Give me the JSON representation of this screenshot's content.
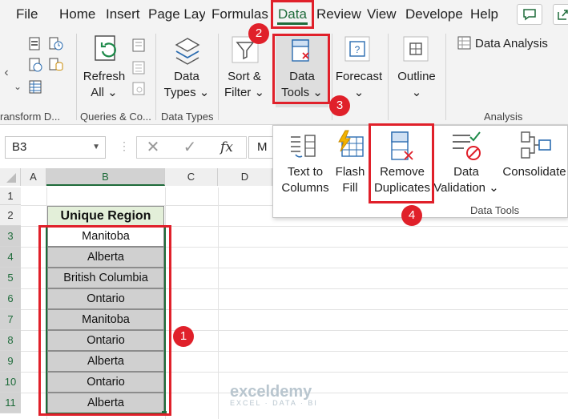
{
  "menu": {
    "tabs": [
      {
        "label": "File"
      },
      {
        "label": "Home"
      },
      {
        "label": "Insert"
      },
      {
        "label": "Page Layo"
      },
      {
        "label": "Formulas"
      },
      {
        "label": "Data"
      },
      {
        "label": "Review"
      },
      {
        "label": "View"
      },
      {
        "label": "Develope"
      },
      {
        "label": "Help"
      }
    ],
    "active_tab": "Data",
    "active_color": "#1e6b3a"
  },
  "ribbon": {
    "groups": {
      "get_transform": "ransform D...",
      "queries": "Queries & Co...",
      "data_types": "Data Types",
      "analysis": "Analysis"
    },
    "buttons": {
      "refresh_all": [
        "Refresh",
        "All ⌄"
      ],
      "data_types": [
        "Data",
        "Types ⌄"
      ],
      "sort_filter": [
        "Sort &",
        "Filter ⌄"
      ],
      "data_tools": [
        "Data",
        "Tools ⌄"
      ],
      "forecast": [
        "Forecast",
        "⌄"
      ],
      "outline": [
        "Outline",
        "⌄"
      ],
      "data_analysis": "Data Analysis"
    },
    "scroll_left": "‹"
  },
  "formula_bar": {
    "name_box": "B3",
    "cancel": "✕",
    "enter": "✓",
    "fx": "fx",
    "content": "M"
  },
  "grid": {
    "columns": [
      "A",
      "B",
      "C",
      "D"
    ],
    "rows": [
      "1",
      "2",
      "3",
      "4",
      "5",
      "6",
      "7",
      "8",
      "9",
      "10",
      "11"
    ],
    "header": "Unique Region",
    "values": [
      "Manitoba",
      "Alberta",
      "British Columbia",
      "Ontario",
      "Manitoba",
      "Ontario",
      "Alberta",
      "Ontario",
      "Alberta"
    ],
    "header_fill": "#e3efd9",
    "selection_fill": "#d0d0d0"
  },
  "data_tools_panel": {
    "buttons": {
      "text_to_columns": [
        "Text to",
        "Columns"
      ],
      "flash_fill": [
        "Flash",
        "Fill"
      ],
      "remove_duplicates": [
        "Remove",
        "Duplicates"
      ],
      "data_validation": [
        "Data",
        "Validation ⌄"
      ],
      "consolidate": "Consolidate"
    },
    "group_label": "Data Tools"
  },
  "annotations": {
    "badges": [
      "1",
      "2",
      "3",
      "4"
    ],
    "color": "#e0202a"
  },
  "watermark": {
    "name": "exceldemy",
    "tagline": "EXCEL · DATA · BI"
  }
}
